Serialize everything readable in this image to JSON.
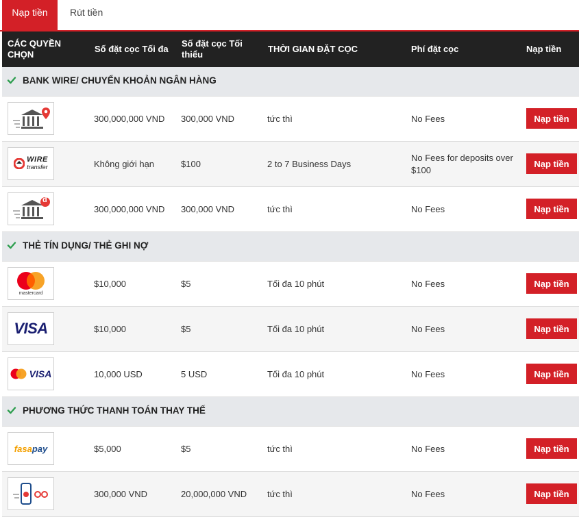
{
  "tabs": {
    "deposit": "Nạp tiền",
    "withdraw": "Rút tiền"
  },
  "headers": {
    "options": "CÁC QUYỀN CHỌN",
    "max": "Số đặt cọc Tối đa",
    "min": "Số đặt cọc Tối thiểu",
    "time": "THỜI GIAN ĐẶT CỌC",
    "fee": "Phí đặt cọc",
    "action": "Nạp tiền"
  },
  "sections": [
    {
      "title": "BANK WIRE/ CHUYỂN KHOẢN NGÂN HÀNG",
      "rows": [
        {
          "logo": "bank-pin-icon",
          "max": "300,000,000 VND",
          "min": "300,000 VND",
          "time": "tức thì",
          "fee": "No Fees",
          "button": "Nạp tiền"
        },
        {
          "logo": "wire-transfer-logo",
          "logo_text": [
            "WIRE",
            "transfer"
          ],
          "max": "Không giới hạn",
          "min": "$100",
          "time": "2 to 7 Business Days",
          "fee": "No Fees for deposits over $100",
          "button": "Nạp tiền"
        },
        {
          "logo": "bank-dong-icon",
          "logo_text": [
            "đ"
          ],
          "max": "300,000,000 VND",
          "min": "300,000 VND",
          "time": "tức thì",
          "fee": "No Fees",
          "button": "Nạp tiền"
        }
      ]
    },
    {
      "title": "THẺ TÍN DỤNG/ THẺ GHI NỢ",
      "rows": [
        {
          "logo": "mastercard-logo",
          "logo_text": [
            "mastercard"
          ],
          "max": "$10,000",
          "min": "$5",
          "time": "Tối đa 10 phút",
          "fee": "No Fees",
          "button": "Nạp tiền"
        },
        {
          "logo": "visa-logo",
          "logo_text": [
            "VISA"
          ],
          "max": "$10,000",
          "min": "$5",
          "time": "Tối đa 10 phút",
          "fee": "No Fees",
          "button": "Nạp tiền"
        },
        {
          "logo": "mastercard-visa-logo",
          "logo_text": [
            "VISA"
          ],
          "max": "10,000 USD",
          "min": "5 USD",
          "time": "Tối đa 10 phút",
          "fee": "No Fees",
          "button": "Nạp tiền"
        }
      ]
    },
    {
      "title": "PHƯƠNG THỨC THANH TOÁN THAY THẾ",
      "rows": [
        {
          "logo": "fasapay-logo",
          "logo_text": [
            "fasa",
            "pay"
          ],
          "max": "$5,000",
          "min": "$5",
          "time": "tức thì",
          "fee": "No Fees",
          "button": "Nạp tiền"
        },
        {
          "logo": "mobile-payment-icon",
          "max": "300,000 VND",
          "min": "20,000,000 VND",
          "time": "tức thì",
          "fee": "No Fees",
          "button": "Nạp tiền"
        }
      ]
    }
  ],
  "colors": {
    "accent": "#d32027",
    "header_bg": "#222222",
    "section_bg": "#e6e8eb",
    "check": "#2e9e4f"
  }
}
